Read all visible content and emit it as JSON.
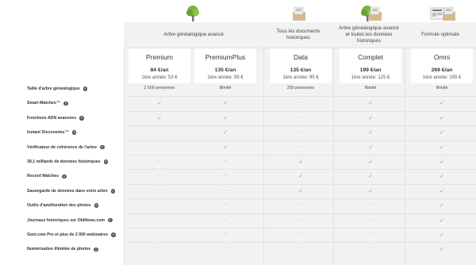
{
  "header_icons": [
    {
      "name": "tree-icon",
      "col": 0
    },
    {
      "name": "documents-box-icon",
      "col": 1
    },
    {
      "name": "tree-icon",
      "col": 2
    },
    {
      "name": "documents-box-icon",
      "col": 2
    },
    {
      "name": "newspaper-icon",
      "col": 3
    },
    {
      "name": "documents-box-icon",
      "col": 3
    }
  ],
  "groups": [
    {
      "label": "Arbre généalogique avancé"
    },
    {
      "label": "Tous les documents historiques"
    },
    {
      "label": "Arbre généalogique avancé et toutes les données historiques"
    },
    {
      "label": "Formule optimale"
    }
  ],
  "plans": [
    {
      "name": "Premium",
      "price": "84 €/an",
      "first_year": "1ère année: 53 €"
    },
    {
      "name": "PremiumPlus",
      "price": "135 €/an",
      "first_year": "1ère année: 95 €"
    },
    {
      "name": "Data",
      "price": "135 €/an",
      "first_year": "1ère année: 95 €"
    },
    {
      "name": "Complet",
      "price": "199 €/an",
      "first_year": "1ère année: 125 €"
    },
    {
      "name": "Omni",
      "price": "269 €/an",
      "first_year": "1ère année: 155 €"
    }
  ],
  "features": [
    {
      "label": "Taille d'arbre généalogique",
      "cells": [
        "2 500 personnes",
        "Illimité",
        "250 personnes",
        "Illimité",
        "Illimité"
      ]
    },
    {
      "label": "Smart Matches™",
      "cells": [
        "check-grey",
        "check-grey",
        "dash",
        "check-grey",
        "check-green"
      ]
    },
    {
      "label": "Fonctions ADN avancées",
      "cells": [
        "check-grey",
        "check-grey",
        "dash",
        "check-grey",
        "check-green"
      ]
    },
    {
      "label": "Instant Discoveries™",
      "cells": [
        "dash",
        "check-grey",
        "dash",
        "check-green",
        "check-green"
      ]
    },
    {
      "label": "Vérificateur de cohérence de l'arbre",
      "cells": [
        "dash",
        "check-grey",
        "dash",
        "check-green",
        "check-green"
      ]
    },
    {
      "label": "39,1 milliards de données historiques",
      "cells": [
        "dash",
        "dash",
        "check-green",
        "check-green",
        "check-green"
      ]
    },
    {
      "label": "Record Matches",
      "cells": [
        "dash",
        "dash",
        "check-green",
        "check-green",
        "check-green"
      ]
    },
    {
      "label": "Sauvegarde de données dans votre arbre",
      "cells": [
        "dash",
        "dash",
        "check-green",
        "check-green",
        "check-green"
      ]
    },
    {
      "label": "Outils d'amélioration des photos",
      "cells": [
        "dash",
        "dash",
        "dash",
        "dash",
        "check-green"
      ]
    },
    {
      "label": "Journaux historiques sur OldNews.com",
      "cells": [
        "dash",
        "dash",
        "dash",
        "dash",
        "check-green"
      ]
    },
    {
      "label": "Geni.com Pro et plus de 2 000 webinaires",
      "cells": [
        "dash",
        "dash",
        "dash",
        "dash",
        "check-green"
      ]
    },
    {
      "label": "Numérisation illimitée de photos",
      "cells": [
        "dash",
        "dash",
        "dash",
        "dash",
        "check-green"
      ]
    }
  ],
  "colors": {
    "check_green": "#6fbf3a",
    "check_grey": "#999999",
    "panel": "#f2f2f2"
  }
}
